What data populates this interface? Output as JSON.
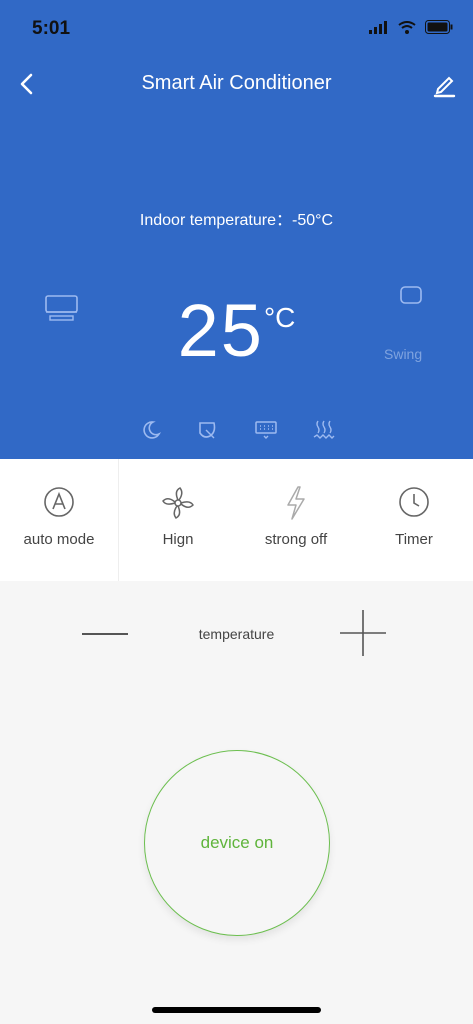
{
  "status": {
    "time": "5:01"
  },
  "header": {
    "title": "Smart Air Conditioner"
  },
  "hero": {
    "indoor_text": "Indoor temperature：-50°C",
    "set_temp": "25",
    "unit": "°C",
    "swing_label": "Swing"
  },
  "modes": [
    {
      "label": "auto mode",
      "icon": "auto-mode-icon"
    },
    {
      "label": "Hign",
      "icon": "fan-icon"
    },
    {
      "label": "strong off",
      "icon": "lightning-icon"
    },
    {
      "label": "Timer",
      "icon": "clock-icon"
    }
  ],
  "temperature_control": {
    "label": "temperature"
  },
  "power": {
    "label": "device on"
  },
  "colors": {
    "primary": "#3169c6",
    "power": "#5fb43b"
  }
}
